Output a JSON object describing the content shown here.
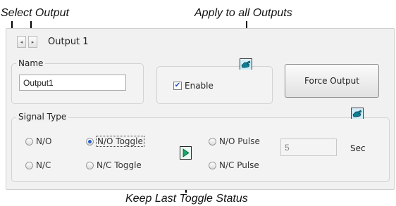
{
  "callouts": {
    "select_output": "Select Output",
    "apply_all": "Apply to all Outputs",
    "keep_last": "Keep Last Toggle Status"
  },
  "header": {
    "title": "Output 1",
    "prev_glyph": "◂",
    "next_glyph": "▸"
  },
  "name_group": {
    "legend": "Name",
    "value": "Output1"
  },
  "enable": {
    "label": "Enable",
    "checked": true,
    "check_glyph": "✔"
  },
  "force_button": {
    "label": "Force Output"
  },
  "signal_type": {
    "legend": "Signal Type",
    "options": [
      {
        "label": "N/O",
        "selected": false
      },
      {
        "label": "N/O Toggle",
        "selected": true
      },
      {
        "label": "N/O Pulse",
        "selected": false
      },
      {
        "label": "N/C",
        "selected": false
      },
      {
        "label": "N/C Toggle",
        "selected": false
      },
      {
        "label": "N/C Pulse",
        "selected": false
      }
    ],
    "pulse_value": "5",
    "pulse_unit": "Sec"
  },
  "icons": {
    "apply_all_icon": "pointing-hand-icon",
    "keep_toggle_icon": "play-triangle-icon"
  },
  "colors": {
    "accent": "#2a5fc9",
    "icon_fill": "#0d7f94",
    "keep_fill": "#17a86a"
  }
}
